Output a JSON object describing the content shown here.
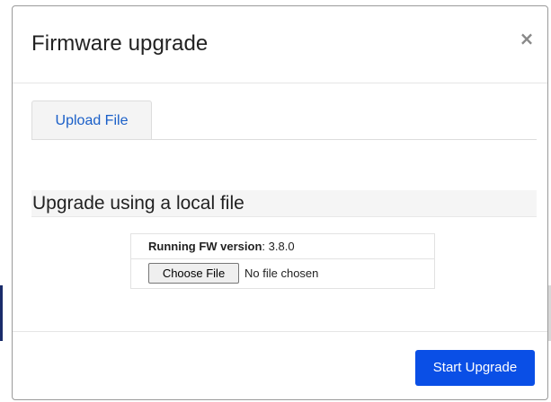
{
  "modal": {
    "title": "Firmware upgrade",
    "close_glyph": "×",
    "close_icon": "close-icon"
  },
  "tabs": [
    {
      "label": "Upload File",
      "active": true
    }
  ],
  "section": {
    "heading": "Upgrade using a local file"
  },
  "firmware": {
    "version_label": "Running FW version",
    "version_separator": ":",
    "version_value": "3.8.0"
  },
  "file_input": {
    "button_label": "Choose File",
    "status_text": "No file chosen"
  },
  "footer": {
    "start_label": "Start Upgrade"
  },
  "colors": {
    "primary_button": "#0a4fe6",
    "tab_text": "#1a5fc8"
  }
}
